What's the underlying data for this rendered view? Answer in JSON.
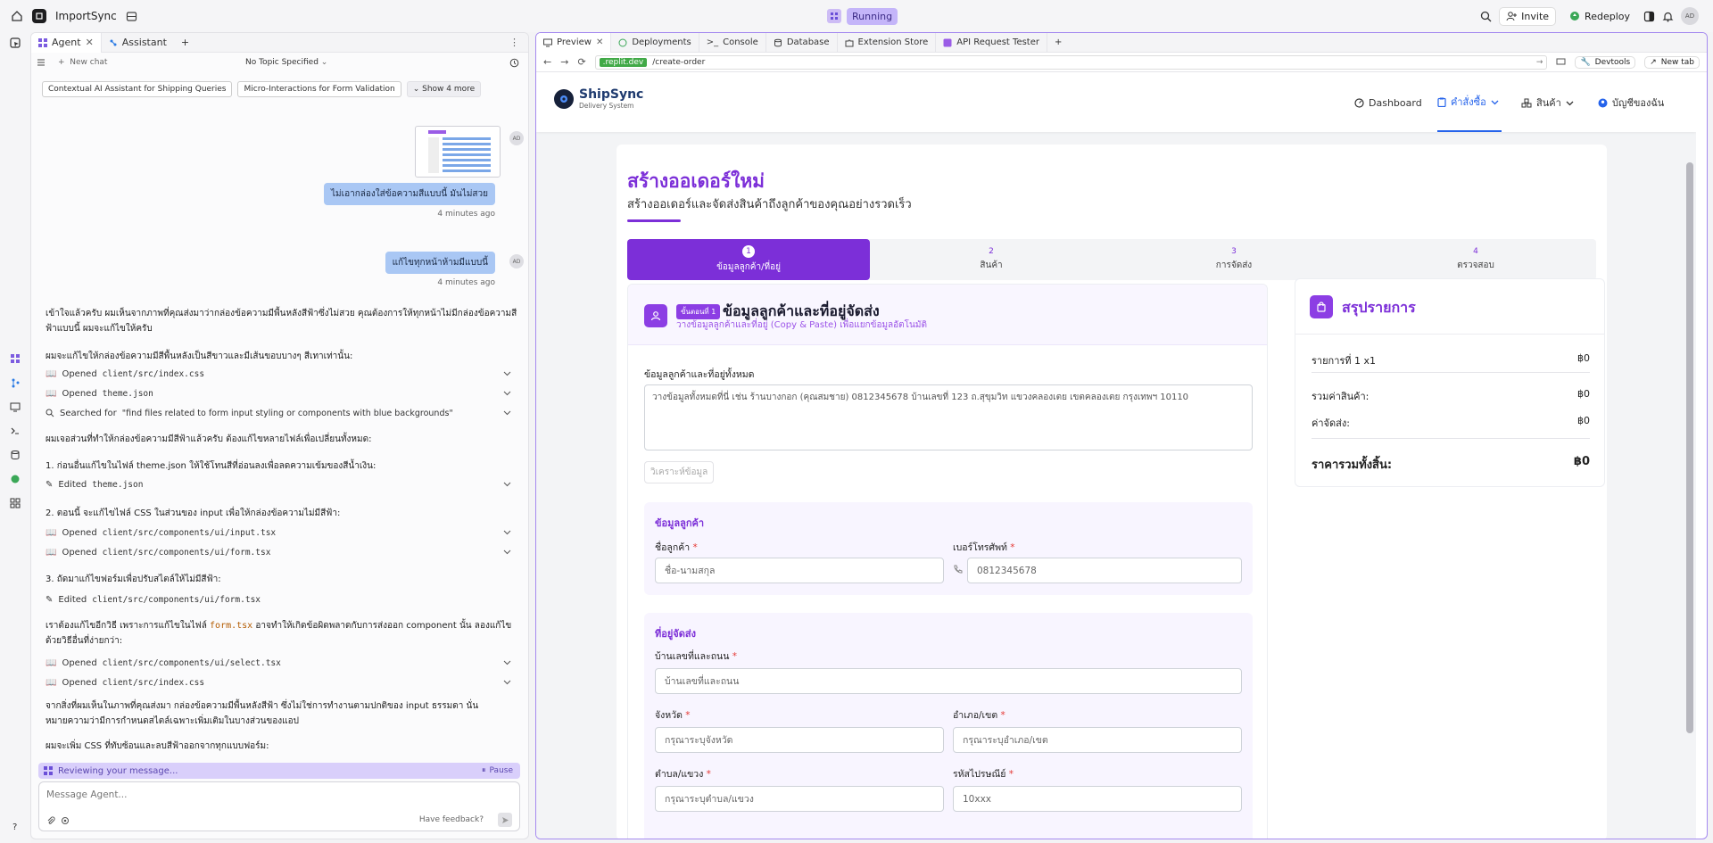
{
  "topbar": {
    "project_name": "ImportSync",
    "status": "Running",
    "invite_label": "Invite",
    "redeploy_label": "Redeploy",
    "avatar_initials": "AD"
  },
  "left_panel": {
    "tabs": [
      {
        "label": "Agent"
      },
      {
        "label": "Assistant"
      }
    ],
    "new_chat_label": "New chat",
    "topic_label": "No Topic Specified",
    "chips": [
      "Contextual AI Assistant for Shipping Queries",
      "Micro-Interactions for Form Validation",
      "Show 4 more"
    ],
    "user_messages": [
      {
        "text": "ไม่เอากล่องใส่ข้อความสีแบบนี้ มันไม่สวย",
        "time": "4 minutes ago"
      },
      {
        "text": "แก้ไขทุกหน้าห้ามมีแบบนี้",
        "time": "4 minutes ago"
      }
    ],
    "avatar_initials": "AD",
    "agent_text_1": "เข้าใจแล้วครับ ผมเห็นจากภาพที่คุณส่งมาว่ากล่องข้อความมีพื้นหลังสีฟ้าซึ่งไม่สวย คุณต้องการให้ทุกหน้าไม่มีกล่องข้อความสีฟ้าแบบนี้ ผมจะแก้ไขให้ครับ",
    "agent_text_2": "ผมจะแก้ไขให้กล่องข้อความมีสีพื้นหลังเป็นสีขาวและมีเส้นขอบบางๆ สีเทาเท่านั้น:",
    "actions_1": [
      {
        "prefix": "Opened",
        "code": "client/src/index.css"
      },
      {
        "prefix": "Opened",
        "code": "theme.json"
      },
      {
        "prefix": "Searched for",
        "code": "\"find files related to form input styling or components with blue backgrounds\""
      }
    ],
    "agent_text_3": "ผมเจอส่วนที่ทำให้กล่องข้อความมีสีฟ้าแล้วครับ ต้องแก้ไขหลายไฟล์เพื่อเปลี่ยนทั้งหมด:",
    "agent_text_4": "1. ก่อนอื่นแก้ไขในไฟล์ theme.json ให้ใช้โทนสีที่อ่อนลงเพื่อลดความเข้มของสีน้ำเงิน:",
    "action_edit_1": {
      "prefix": "Edited",
      "code": "theme.json"
    },
    "agent_text_5": "2. ตอนนี้ จะแก้ไขไฟล์ CSS ในส่วนของ input เพื่อให้กล่องข้อความไม่มีสีฟ้า:",
    "actions_2": [
      {
        "prefix": "Opened",
        "code": "client/src/components/ui/input.tsx"
      },
      {
        "prefix": "Opened",
        "code": "client/src/components/ui/form.tsx"
      }
    ],
    "agent_text_6": "3. ถัดมาแก้ไขฟอร์มเพื่อปรับสไตล์ให้ไม่มีสีฟ้า:",
    "action_edit_2": {
      "prefix": "Edited",
      "code": "client/src/components/ui/form.tsx"
    },
    "agent_text_7a": "เราต้องแก้ไขอีกวิธี เพราะการแก้ไขในไฟล์ ",
    "agent_text_7_code": "form.tsx",
    "agent_text_7b": " อาจทำให้เกิดข้อผิดพลาดกับการส่งออก component นั้น ลองแก้ไขด้วยวิธีอื่นที่ง่ายกว่า:",
    "actions_3": [
      {
        "prefix": "Opened",
        "code": "client/src/components/ui/select.tsx"
      },
      {
        "prefix": "Opened",
        "code": "client/src/index.css"
      }
    ],
    "agent_text_8": "จากสิ่งที่ผมเห็นในภาพที่คุณส่งมา กล่องข้อความมีพื้นหลังสีฟ้า ซึ่งไม่ใช่การทำงานตามปกติของ input ธรรมดา นั่นหมายความว่ามีการกำหนดสไตล์เฉพาะเพิ่มเติมในบางส่วนของแอป",
    "agent_text_9": "ผมจะเพิ่ม CSS ที่ทับซ้อนและลบสีฟ้าออกจากทุกแบบฟอร์ม:",
    "reviewing_label": "Reviewing your message...",
    "pause_label": "Pause",
    "input_placeholder": "Message Agent...",
    "feedback_label": "Have feedback?"
  },
  "right_panel": {
    "tabs": [
      {
        "label": "Preview"
      },
      {
        "label": "Deployments"
      },
      {
        "label": "Console"
      },
      {
        "label": "Database"
      },
      {
        "label": "Extension Store"
      },
      {
        "label": "API Request Tester"
      }
    ],
    "url_domain": ".replit.dev",
    "url_path": "/create-order",
    "devtools_label": "Devtools",
    "newtab_label": "New tab"
  },
  "site": {
    "brand_name": "ShipSync",
    "brand_sub": "Delivery System",
    "nav": [
      {
        "label": "Dashboard"
      },
      {
        "label": "คำสั่งซื้อ"
      },
      {
        "label": "สินค้า"
      },
      {
        "label": "บัญชีของฉัน"
      }
    ],
    "page_title": "สร้างออเดอร์ใหม่",
    "page_subtitle": "สร้างออเดอร์และจัดส่งสินค้าถึงลูกค้าของคุณอย่างรวดเร็ว",
    "steps": [
      {
        "num": "1",
        "label": "ข้อมูลลูกค้า/ที่อยู่"
      },
      {
        "num": "2",
        "label": "สินค้า"
      },
      {
        "num": "3",
        "label": "การจัดส่ง"
      },
      {
        "num": "4",
        "label": "ตรวจสอบ"
      }
    ],
    "form": {
      "step_badge": "ขั้นตอนที่ 1",
      "title": "ข้อมูลลูกค้าและที่อยู่จัดส่ง",
      "subtitle": "วางข้อมูลลูกค้าและที่อยู่ (Copy & Paste) เพื่อแยกข้อมูลอัตโนมัติ",
      "all_info_label": "ข้อมูลลูกค้าและที่อยู่ทั้งหมด",
      "all_info_placeholder": "วางข้อมูลทั้งหมดที่นี่ เช่น ร้านบางกอก (คุณสมชาย) 0812345678 บ้านเลขที่ 123 ถ.สุขุมวิท แขวงคลองเตย เขตคลองเตย กรุงเทพฯ 10110",
      "analyze_label": "วิเคราะห์ข้อมูล",
      "customer_section": "ข้อมูลลูกค้า",
      "name_label": "ชื่อลูกค้า",
      "name_placeholder": "ชื่อ-นามสกุล",
      "phone_label": "เบอร์โทรศัพท์",
      "phone_placeholder": "0812345678",
      "address_section": "ที่อยู่จัดส่ง",
      "street_label": "บ้านเลขที่และถนน",
      "street_placeholder": "บ้านเลขที่และถนน",
      "province_label": "จังหวัด",
      "province_placeholder": "กรุณาระบุจังหวัด",
      "district_label": "อำเภอ/เขต",
      "district_placeholder": "กรุณาระบุอำเภอ/เขต",
      "subdistrict_label": "ตำบล/แขวง",
      "subdistrict_placeholder": "กรุณาระบุตำบล/แขวง",
      "postal_label": "รหัสไปรษณีย์",
      "postal_placeholder": "10xxx",
      "required_mark": "*"
    },
    "summary": {
      "title": "สรุปรายการ",
      "item_label": "รายการที่ 1 x1",
      "item_value": "฿0",
      "subtotal_label": "รวมค่าสินค้า:",
      "subtotal_value": "฿0",
      "shipping_label": "ค่าจัดส่ง:",
      "shipping_value": "฿0",
      "total_label": "ราคารวมทั้งสิ้น:",
      "total_value": "฿0"
    }
  },
  "colors": {
    "accent": "#7c2fd8",
    "link_blue": "#2563eb",
    "running_bg": "#c4b5f9",
    "bubble_blue": "#a9c7f4"
  }
}
